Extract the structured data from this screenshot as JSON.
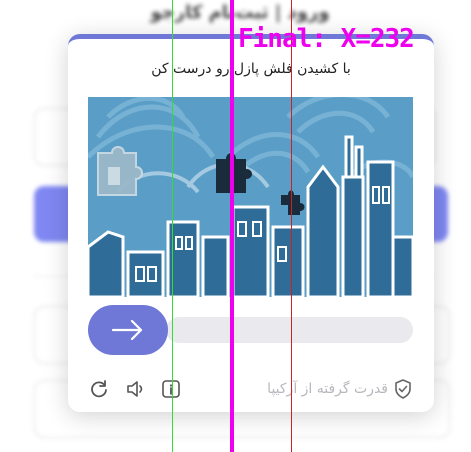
{
  "background": {
    "title": "ورود | ثبت‌نام کارجو"
  },
  "captcha": {
    "title": "با کشیدن فلش پازل رو درست کن",
    "powered_by": "قدرت گرفته از آرکیپا",
    "colors": {
      "accent": "#6f78d6",
      "track": "#e9e9ee",
      "image_bg": "#5a9ec7",
      "building": "#2f6c98"
    },
    "icons": {
      "slider_handle": "arrow-right-icon",
      "refresh": "refresh-icon",
      "audio": "speaker-icon",
      "info": "info-icon",
      "shield": "shield-check-icon"
    }
  },
  "overlay": {
    "final_label": "Final: X=232"
  }
}
